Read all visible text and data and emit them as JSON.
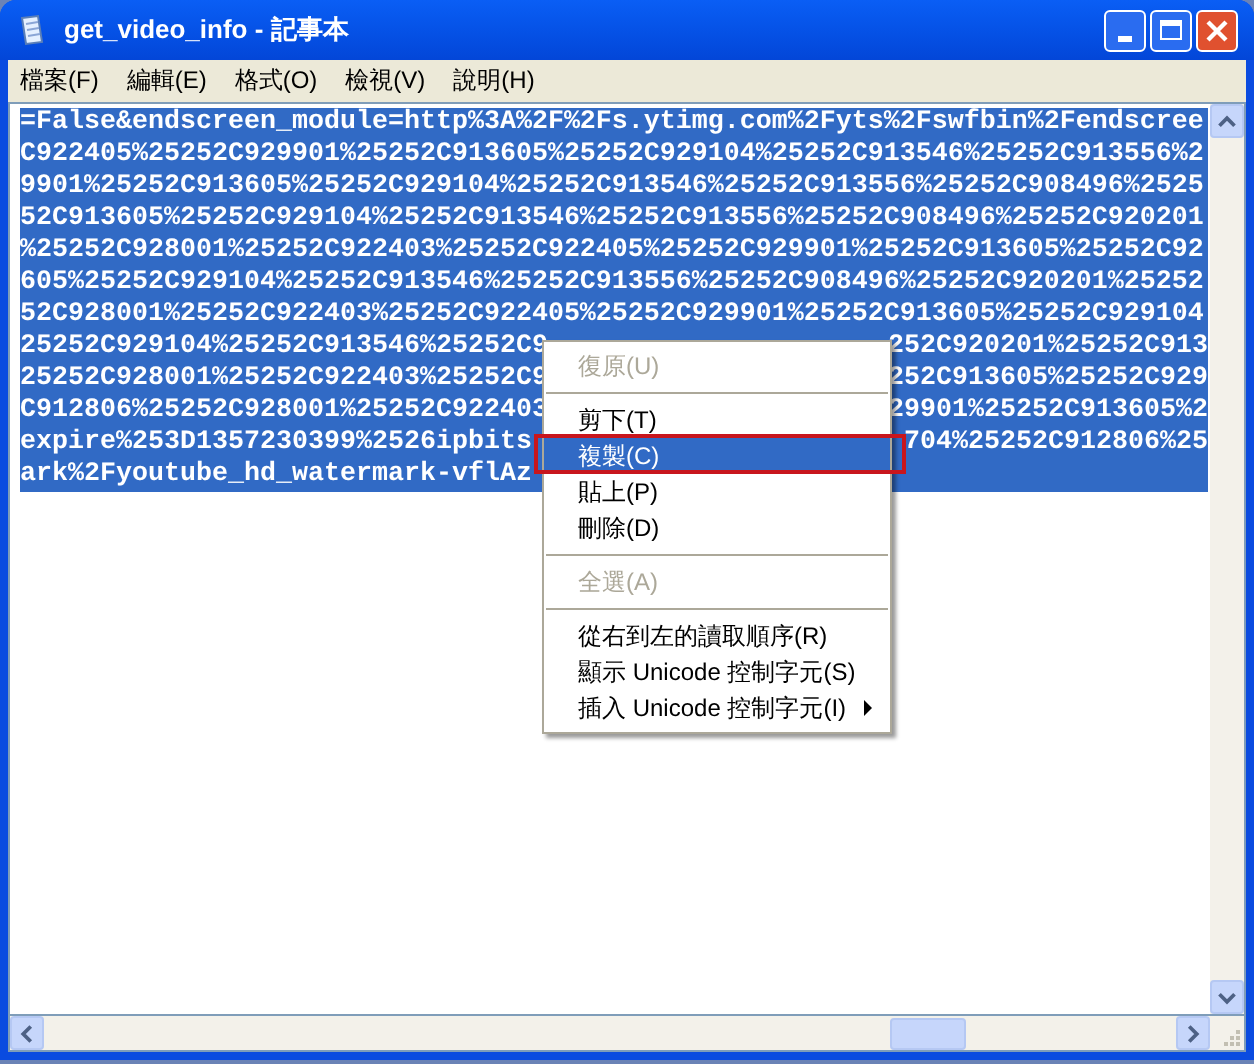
{
  "window": {
    "title": "get_video_info - 記事本"
  },
  "menu_bar": [
    "檔案(F)",
    "編輯(E)",
    "格式(O)",
    "檢視(V)",
    "說明(H)"
  ],
  "editor": {
    "lines": [
      {
        "text": "=False&endscreen_module=http%3A%2F%2Fs.ytimg.com%2Fyts%2Fswfbin%2Fendscree",
        "selected": true
      },
      {
        "text": "C922405%25252C929901%25252C913605%25252C929104%25252C913546%25252C913556%2",
        "selected": true
      },
      {
        "text": "9901%25252C913605%25252C929104%25252C913546%25252C913556%25252C908496%2525",
        "selected": true
      },
      {
        "text": "52C913605%25252C929104%25252C913546%25252C913556%25252C908496%25252C920201",
        "selected": true
      },
      {
        "text": "%25252C928001%25252C922403%25252C922405%25252C929901%25252C913605%25252C92",
        "selected": true
      },
      {
        "text": "605%25252C929104%25252C913546%25252C913556%25252C908496%25252C920201%25252",
        "selected": true
      },
      {
        "text": "52C928001%25252C922403%25252C922405%25252C929901%25252C913605%25252C929104",
        "selected": true
      },
      {
        "text": "25252C929104%25252C913546%25252C9",
        "text_after_menu": "252C920201%25252C913",
        "selected": true
      },
      {
        "text": "25252C928001%25252C922403%25252C9",
        "text_after_menu": "252C913605%25252C929",
        "selected": true
      },
      {
        "text": "C912806%25252C928001%25252C922403",
        "text_after_menu": "29901%25252C913605%2",
        "selected": true
      },
      {
        "text": "expire%253D1357230399%2526ipbits",
        "text_after_menu": "704%25252C912806%25",
        "selected": true
      },
      {
        "text": "ark%2Fyoutube_hd_watermark-vflAz",
        "selected": true
      }
    ]
  },
  "context_menu": [
    {
      "kind": "item",
      "label": "復原(U)",
      "disabled": true,
      "selected": false
    },
    {
      "kind": "separator"
    },
    {
      "kind": "item",
      "label": "剪下(T)",
      "disabled": false,
      "selected": false
    },
    {
      "kind": "item",
      "label": "複製(C)",
      "disabled": false,
      "selected": true,
      "annotated": true
    },
    {
      "kind": "item",
      "label": "貼上(P)",
      "disabled": false,
      "selected": false
    },
    {
      "kind": "item",
      "label": "刪除(D)",
      "disabled": false,
      "selected": false
    },
    {
      "kind": "separator"
    },
    {
      "kind": "item",
      "label": "全選(A)",
      "disabled": true,
      "selected": false
    },
    {
      "kind": "separator"
    },
    {
      "kind": "item",
      "label": "從右到左的讀取順序(R)",
      "disabled": false,
      "selected": false
    },
    {
      "kind": "item",
      "label": "顯示 Unicode 控制字元(S)",
      "disabled": false,
      "selected": false
    },
    {
      "kind": "item",
      "label": "插入 Unicode 控制字元(I)",
      "disabled": false,
      "selected": false,
      "submenu": true
    }
  ]
}
